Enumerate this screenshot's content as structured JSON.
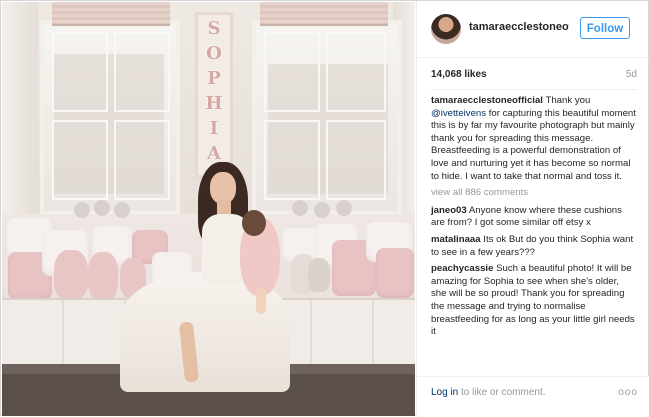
{
  "banner": {
    "letters": [
      "S",
      "O",
      "P",
      "H",
      "I",
      "A"
    ]
  },
  "post": {
    "username": "tamaraecclestoneoff...",
    "follow_label": "Follow",
    "likes": "14,068 likes",
    "age": "5d"
  },
  "comments": [
    {
      "user": "tamaraecclestoneofficial",
      "text_pre": "Thank you ",
      "mention": "@ivetteivens",
      "text": " for capturing this beautiful moment this is by far my favourite photograph but mainly thank you for spreading this message. Breastfeeding is a powerful demonstration of love and nurturing yet it has become so normal to hide. I want to take that normal and toss it."
    },
    {
      "user": "janeo03",
      "text": "Anyone know where these cushions are from? I got some similar off etsy x"
    },
    {
      "user": "matalinaaa",
      "text": "Its ok But do you think Sophia want to see in a few years???"
    },
    {
      "user": "peachycassie",
      "text": "Such a beautiful photo! It will be amazing for Sophia to see when she's older, she will be so proud! Thank you for spreading the message and trying to normalise breastfeeding for as long as your little girl needs it"
    }
  ],
  "view_all": "view all 886 comments",
  "footer": {
    "login_link": "Log in",
    "login_text": " to like or comment.",
    "more": "ooo"
  }
}
